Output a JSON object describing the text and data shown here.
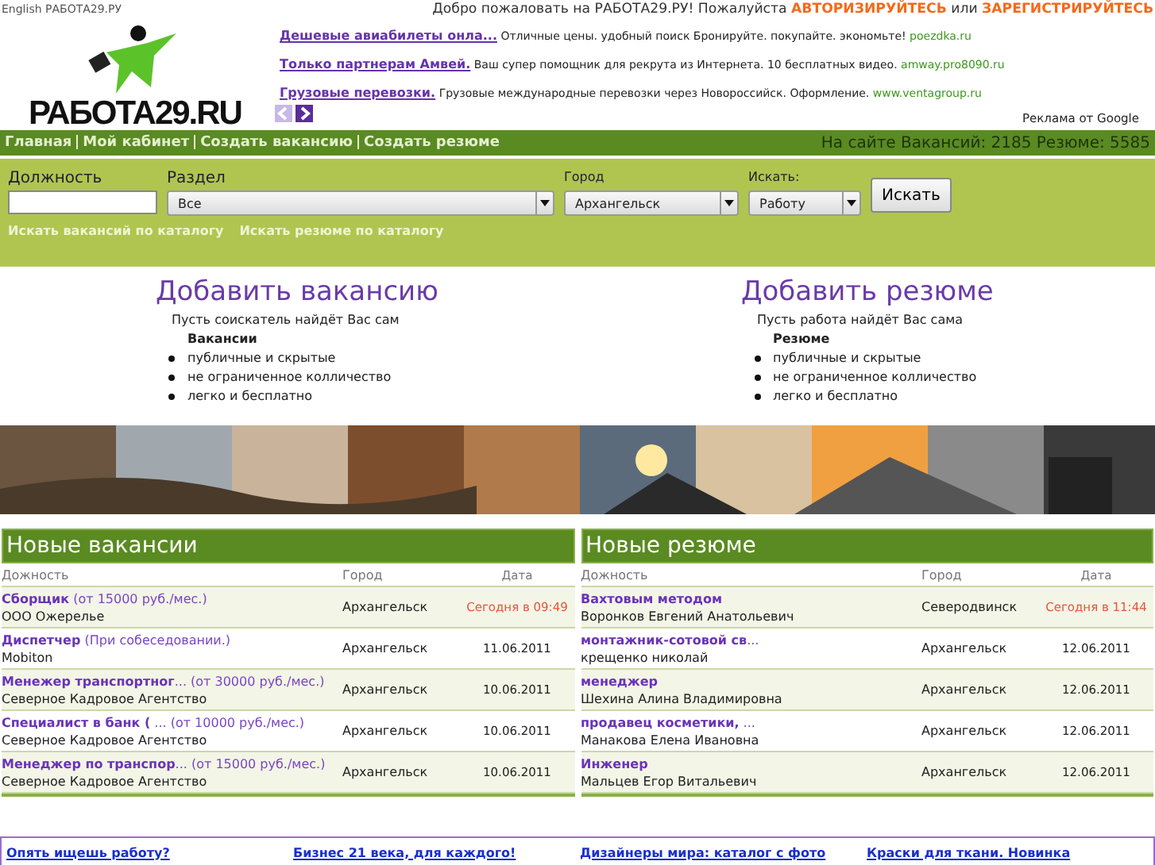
{
  "top_bar": {
    "language_link": "English РАБОТА29.РУ",
    "welcome": "Добро пожаловать на РАБОТА29.РУ! Пожалуйста",
    "login_link": "АВТОРИЗИРУЙТЕСЬ",
    "or": "или",
    "register_link": "ЗАРЕГИСТРИРУЙТЕСЬ"
  },
  "logo": {
    "text": "РАБОТА29.RU"
  },
  "ads": [
    {
      "title": "Дешевые авиабилеты онла...",
      "text": "Отличные цены. удобный поиск Бронируйте. покупайте. экономьте!",
      "url": "poezdka.ru"
    },
    {
      "title": "Только партнерам Амвей.",
      "text": "Ваш супер помощник для рекрута из Интернета. 10 бесплатных видео.",
      "url": "amway.pro8090.ru"
    },
    {
      "title": "Грузовые перевозки.",
      "text": "Грузовые международные перевозки через Новороссийск. Оформление.",
      "url": "www.ventagroup.ru"
    }
  ],
  "ads_label": "Реклама от Google",
  "nav": {
    "items": [
      "Главная",
      "Мой кабинет",
      "Создать вакансию",
      "Создать резюме"
    ],
    "stats": "На сайте Вакансий: 2185 Резюме: 5585"
  },
  "search": {
    "position_label": "Должность",
    "section_label": "Раздел",
    "section_value": "Все",
    "city_label": "Город",
    "city_value": "Архангельск",
    "find_label": "Искать:",
    "find_value": "Работу",
    "button": "Искать",
    "links": [
      "Искать вакансий по каталогу",
      "Искать резюме по каталогу"
    ]
  },
  "promos": [
    {
      "title": "Добавить вакансию",
      "subtitle": "Пусть соискатель найдёт Вас сам",
      "heading": "Вакансии",
      "bullets": [
        "публичные и скрытые",
        "не ограниченное колличество",
        "легко и бесплатно"
      ]
    },
    {
      "title": "Добавить резюме",
      "subtitle": "Пусть работа найдёт Вас сама",
      "heading": "Резюме",
      "bullets": [
        "публичные и скрытые",
        "не ограниченное колличество",
        "легко и бесплатно"
      ]
    }
  ],
  "photo_strip": {
    "kind": "picture"
  },
  "tables": [
    {
      "title": "Новые вакансии",
      "columns": [
        "Дожность",
        "Город",
        "Дата"
      ],
      "rows": [
        {
          "position": "**Сборщик** (от 15000 руб./мес.)",
          "name": "ООО Ожерелье",
          "city": "Архангельск",
          "date": "Сегодня в 09:49",
          "today": true
        },
        {
          "position": "**Диспетчер** (При собеседовании.)",
          "name": "Mobiton",
          "city": "Архангельск",
          "date": "11.06.2011",
          "today": false
        },
        {
          "position": "**Менежер транспортног**... (от 30000 руб./мес.)",
          "name": "Северное Кадровое Агентство",
          "city": "Архангельск",
          "date": "10.06.2011",
          "today": false
        },
        {
          "position": "**Специалист в банк (** ... (от 10000 руб./мес.)",
          "name": "Северное Кадровое Агентство",
          "city": "Архангельск",
          "date": "10.06.2011",
          "today": false
        },
        {
          "position": "**Менеджер по транспор**... (от 15000 руб./мес.)",
          "name": "Северное Кадровое Агентство",
          "city": "Архангельск",
          "date": "10.06.2011",
          "today": false
        }
      ]
    },
    {
      "title": "Новые резюме",
      "columns": [
        "Дожность",
        "Город",
        "Дата"
      ],
      "rows": [
        {
          "position": "**Вахтовым методом**",
          "name": "Воронков Евгений Анатольевич",
          "city": "Северодвинск",
          "date": "Сегодня в 11:44",
          "today": true
        },
        {
          "position": "**монтажник-сотовой св**...",
          "name": "крещенко николай",
          "city": "Архангельск",
          "date": "12.06.2011",
          "today": false
        },
        {
          "position": "**менеджер**",
          "name": "Шехина Алина Владимировна",
          "city": "Архангельск",
          "date": "12.06.2011",
          "today": false
        },
        {
          "position": "**продавец косметики,** ...",
          "name": "Манакова Елена Ивановна",
          "city": "Архангельск",
          "date": "12.06.2011",
          "today": false
        },
        {
          "position": "**Инженер**",
          "name": "Мальцев Егор Витальевич",
          "city": "Архангельск",
          "date": "12.06.2011",
          "today": false
        }
      ]
    }
  ],
  "bottom_ads": [
    "Опять ищешь работу?",
    "Бизнес 21 века, для каждого!",
    "Дизайнеры мира: каталог с фото",
    "Краски для ткани. Новинка"
  ]
}
